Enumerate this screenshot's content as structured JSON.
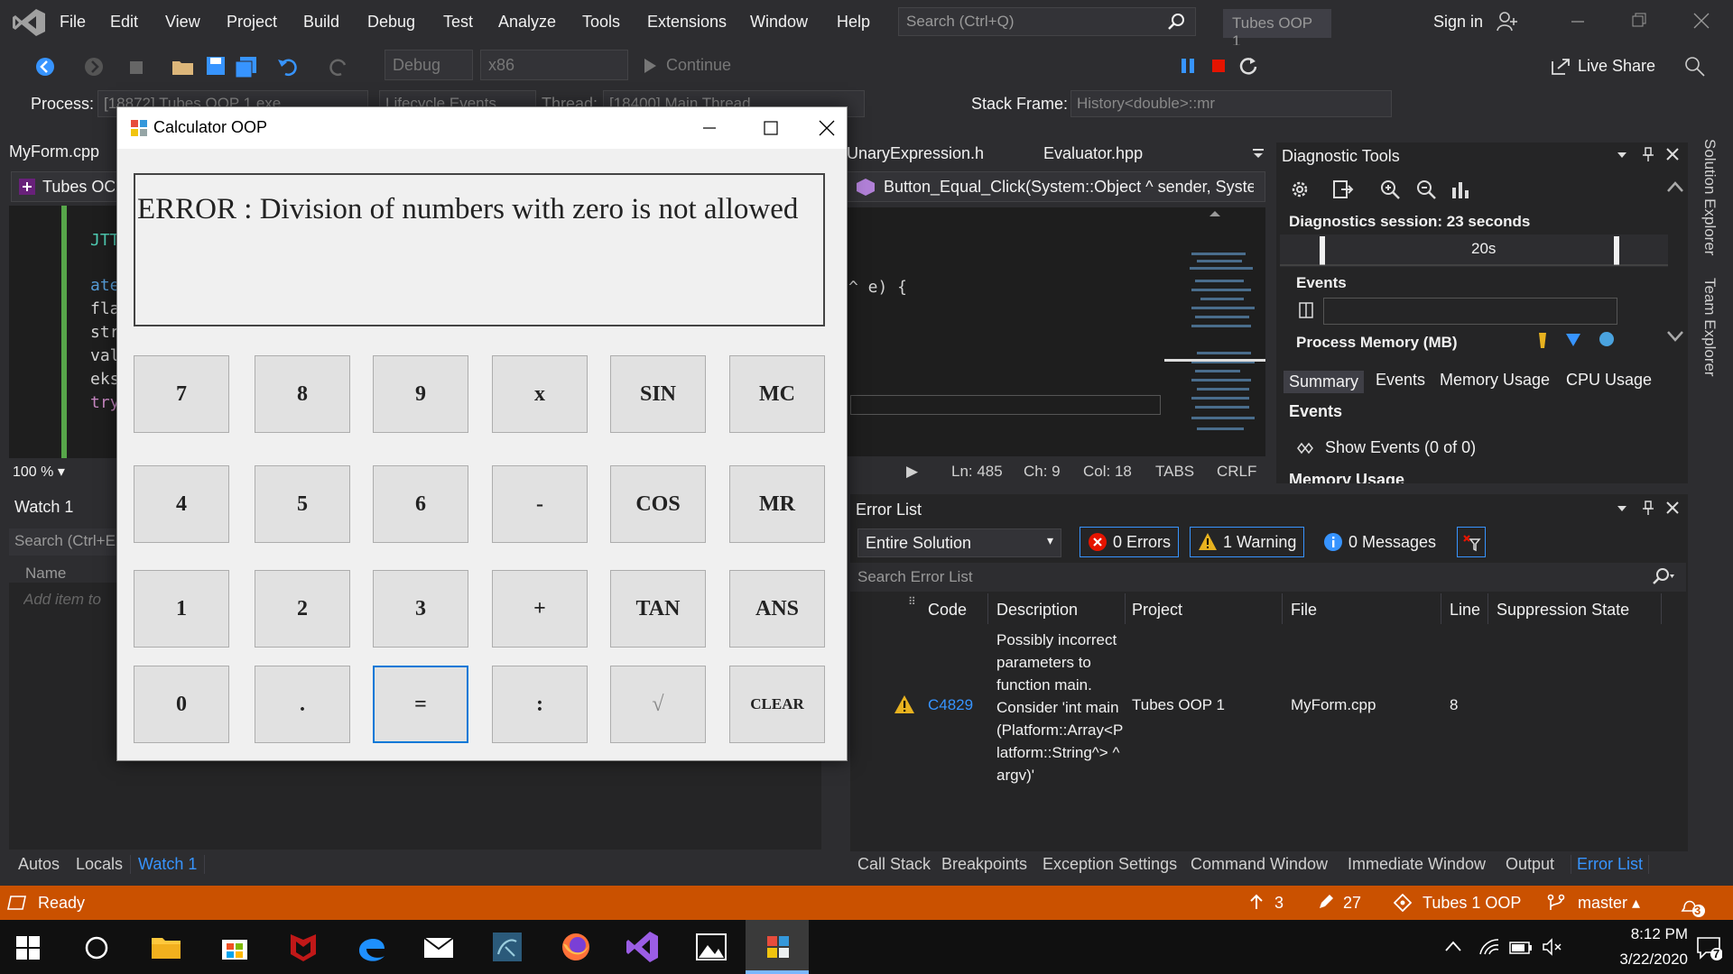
{
  "menu": {
    "items": [
      "File",
      "Edit",
      "View",
      "Project",
      "Build",
      "Debug",
      "Test",
      "Analyze",
      "Tools",
      "Extensions",
      "Window",
      "Help"
    ],
    "search_placeholder": "Search (Ctrl+Q)",
    "solution_title": "Tubes OOP 1",
    "sign_in": "Sign in"
  },
  "toolbar": {
    "config": "Debug",
    "platform": "x86",
    "continue": "Continue",
    "live_share": "Live Share"
  },
  "toolbar2": {
    "process_label": "Process:",
    "process_value": "[18872] Tubes OOP 1.exe",
    "lifecycle": "Lifecycle Events",
    "thread_label": "Thread:",
    "thread_value": "[18400] Main Thread",
    "stackframe_label": "Stack Frame:",
    "stackframe_value": "History<double>::mr"
  },
  "left_editor": {
    "tab": "MyForm.cpp",
    "nav": "Tubes OC",
    "code_lines": [
      "JTTO",
      "ate:",
      "flag",
      "stri",
      "val",
      "eksp",
      "try"
    ],
    "zoom": "100 %"
  },
  "watch": {
    "title": "Watch 1",
    "search": "Search (Ctrl+E",
    "name_col": "Name",
    "add_item": "Add item to"
  },
  "bottom_left_tabs": [
    "Autos",
    "Locals",
    "Watch 1"
  ],
  "editor": {
    "tabs": [
      "UnaryExpression.h",
      "Evaluator.hpp"
    ],
    "nav": "Button_Equal_Click(System::Object ^ sender, Syste",
    "code_line": "^ e) {",
    "status": {
      "ln": "Ln: 485",
      "ch": "Ch: 9",
      "col": "Col: 18",
      "tabs": "TABS",
      "eol": "CRLF"
    }
  },
  "diagnostic": {
    "title": "Diagnostic Tools",
    "session": "Diagnostics session: 23 seconds",
    "timeline_label": "20s",
    "events": "Events",
    "process_memory": "Process Memory (MB)",
    "tabs": [
      "Summary",
      "Events",
      "Memory Usage",
      "CPU Usage"
    ],
    "events_heading": "Events",
    "show_events": "Show Events (0 of 0)",
    "memory_heading": "Memory Usage"
  },
  "side_tabs": [
    "Solution Explorer",
    "Team Explorer"
  ],
  "error_list": {
    "title": "Error List",
    "scope": "Entire Solution",
    "errors": "0 Errors",
    "warnings": "1 Warning",
    "messages": "0 Messages",
    "search": "Search Error List",
    "columns": [
      "Code",
      "Description",
      "Project",
      "File",
      "Line",
      "Suppression State"
    ],
    "rows": [
      {
        "code": "C4829",
        "description": "Possibly incorrect parameters to function main. Consider 'int main (Platform::Array<P latform::String^> ^ argv)'",
        "project": "Tubes OOP 1",
        "file": "MyForm.cpp",
        "line": "8",
        "suppression": ""
      }
    ]
  },
  "bottom_right_tabs": [
    "Call Stack",
    "Breakpoints",
    "Exception Settings",
    "Command Window",
    "Immediate Window",
    "Output",
    "Error List"
  ],
  "statusbar": {
    "ready": "Ready",
    "up": "3",
    "pencil": "27",
    "repo": "Tubes 1 OOP",
    "branch": "master",
    "notifications": "3",
    "color": "#ca5100"
  },
  "taskbar": {
    "time": "8:12 PM",
    "date": "3/22/2020",
    "notif_count": "7"
  },
  "calculator": {
    "title": "Calculator OOP",
    "display": "ERROR : Division of numbers with zero is not allowed",
    "keys": [
      [
        "7",
        "8",
        "9",
        "x",
        "SIN",
        "MC"
      ],
      [
        "4",
        "5",
        "6",
        "-",
        "COS",
        "MR"
      ],
      [
        "1",
        "2",
        "3",
        "+",
        "TAN",
        "ANS"
      ],
      [
        "0",
        ".",
        "=",
        ":",
        "√",
        "CLEAR"
      ]
    ]
  }
}
